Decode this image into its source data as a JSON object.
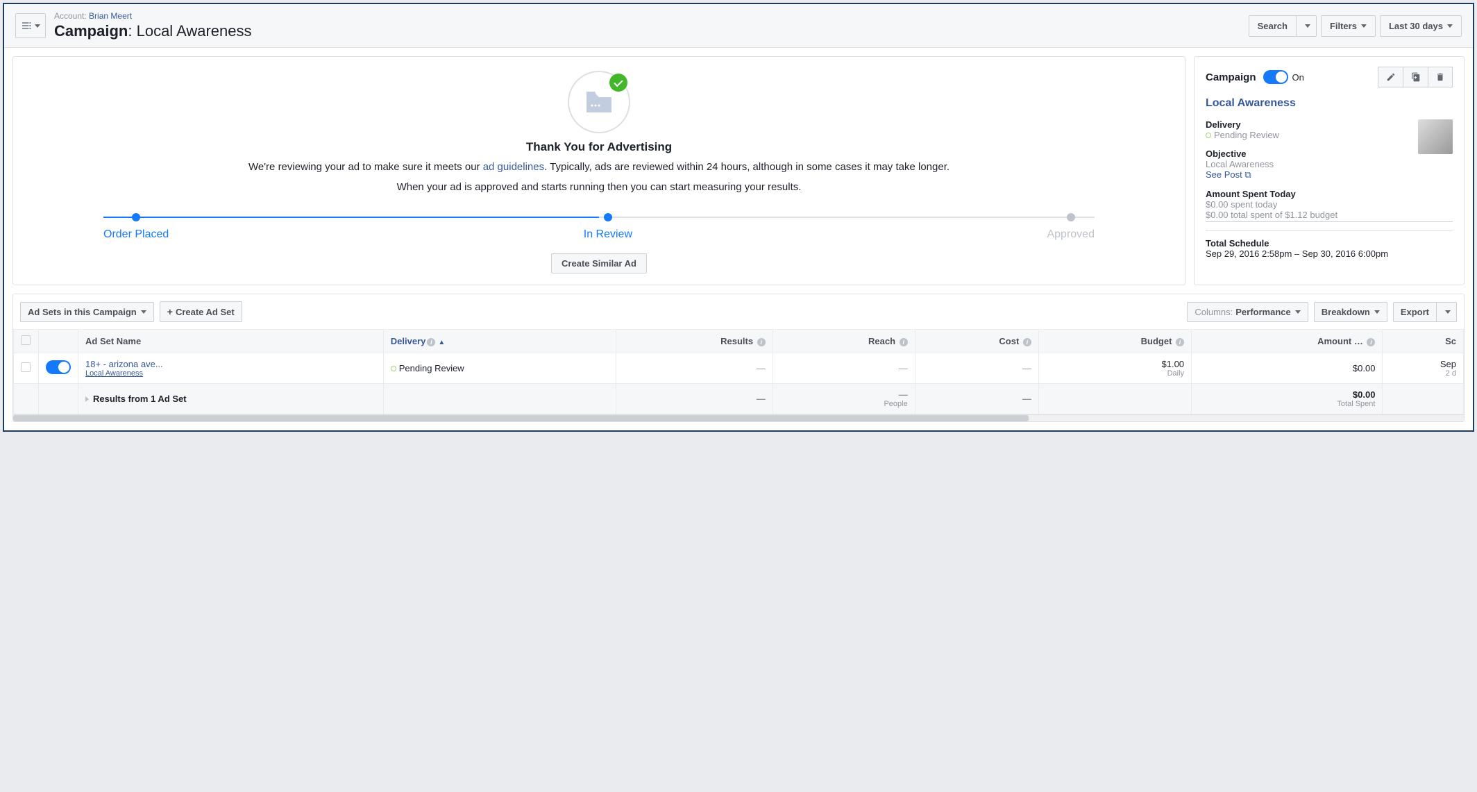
{
  "header": {
    "account_label": "Account:",
    "account_name": "Brian Meert",
    "campaign_label": "Campaign",
    "campaign_name": "Local Awareness",
    "search": "Search",
    "filters": "Filters",
    "date_range": "Last 30 days"
  },
  "review": {
    "title": "Thank You for Advertising",
    "text_before": "We're reviewing your ad to make sure it meets our ",
    "guidelines_link": "ad guidelines",
    "text_after": ". Typically, ads are reviewed within 24 hours, although in some cases it may take longer.",
    "text2": "When your ad is approved and starts running then you can start measuring your results.",
    "step1": "Order Placed",
    "step2": "In Review",
    "step3": "Approved",
    "create_similar": "Create Similar Ad"
  },
  "side": {
    "campaign_label": "Campaign",
    "status": "On",
    "name": "Local Awareness",
    "delivery_label": "Delivery",
    "delivery_value": "Pending Review",
    "objective_label": "Objective",
    "objective_value": "Local Awareness",
    "see_post": "See Post",
    "spent_label": "Amount Spent Today",
    "spent_today": "$0.00 spent today",
    "spent_total": "$0.00 total spent of $1.12 budget",
    "schedule_label": "Total Schedule",
    "schedule_value": "Sep 29, 2016 2:58pm – Sep 30, 2016 6:00pm"
  },
  "table": {
    "dropdown": "Ad Sets in this Campaign",
    "create": "Create Ad Set",
    "columns_label": "Columns:",
    "columns_value": "Performance",
    "breakdown": "Breakdown",
    "export": "Export",
    "headers": {
      "name": "Ad Set Name",
      "delivery": "Delivery",
      "results": "Results",
      "reach": "Reach",
      "cost": "Cost",
      "budget": "Budget",
      "amount": "Amount …",
      "schedule": "Sc"
    },
    "row": {
      "name": "18+ - arizona ave...",
      "sub": "Local Awareness",
      "delivery": "Pending Review",
      "results": "—",
      "reach": "—",
      "cost": "—",
      "budget": "$1.00",
      "budget_sub": "Daily",
      "amount": "$0.00",
      "schedule": "Sep",
      "schedule_sub": "2 d"
    },
    "summary": {
      "label": "Results from 1 Ad Set",
      "results": "—",
      "reach": "—",
      "reach_sub": "People",
      "cost": "—",
      "amount": "$0.00",
      "amount_sub": "Total Spent"
    }
  }
}
